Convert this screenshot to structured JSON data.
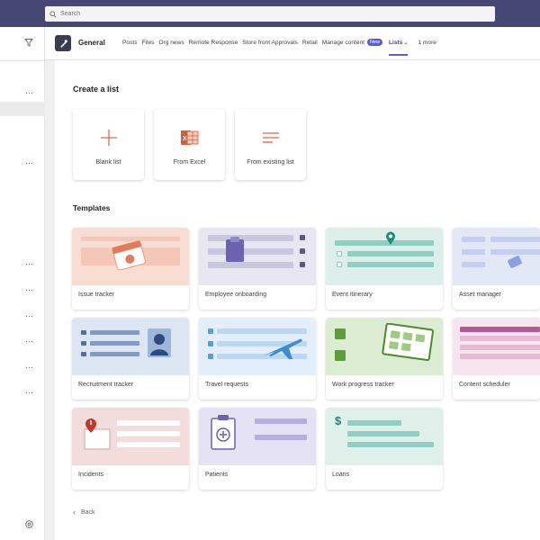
{
  "search": {
    "placeholder": "Search"
  },
  "channel": {
    "name": "General"
  },
  "tabs": [
    "Posts",
    "Files",
    "Org news",
    "Remote Response",
    "Store front Approvals",
    "Retail",
    "Manage content"
  ],
  "tab_badge": "New",
  "active_tab": "Lists",
  "more_tab": "1 more",
  "create": {
    "title": "Create a list",
    "options": [
      "Blank list",
      "From Excel",
      "From existing list"
    ]
  },
  "templates": {
    "title": "Templates",
    "items": [
      "Issue tracker",
      "Employee onboarding",
      "Event itinerary",
      "Asset manager",
      "Recruitment tracker",
      "Travel requests",
      "Work progress tracker",
      "Content scheduler",
      "Incidents",
      "Patients",
      "Loans"
    ]
  },
  "back_label": "Back",
  "colors": {
    "titlebar": "#464775",
    "accent": "#5b5fc7",
    "office_orange": "#d83b01"
  }
}
